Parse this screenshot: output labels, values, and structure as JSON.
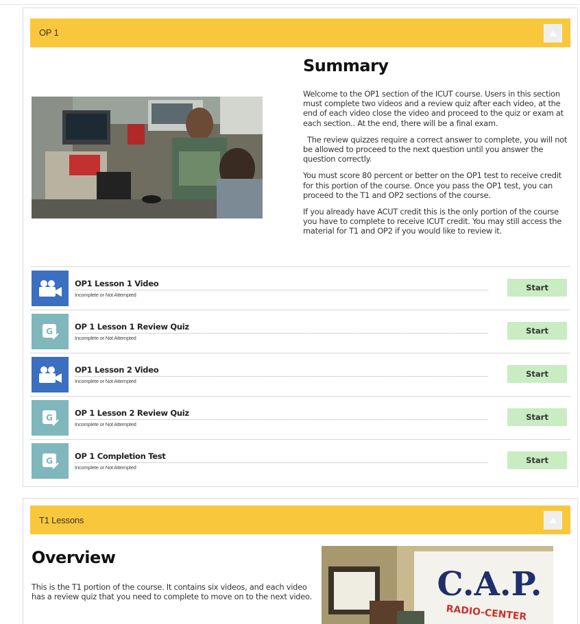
{
  "sections": [
    {
      "title": "OP 1",
      "summary": {
        "heading": "Summary",
        "paragraphs": [
          "Welcome to the OP1 section of the ICUT course. Users in this section must complete two videos and a review quiz after each video, at the end of each video close the video and proceed to the quiz or exam at each section.. At the end, there will be a final exam.",
          "The review quizzes require a correct answer to complete, you will not be allowed to proceed to the next question until you answer the question correctly.",
          "You must score 80 percent or better on the OP1 test to receive credit for this portion of the course. Once you pass the OP1 test, you can proceed to the T1 and OP2 sections of the course.",
          "If you already have ACUT credit this is the only portion of the course you have to complete to receive ICUT credit. You may still access the material for T1 and OP2 if you would like to review it."
        ]
      },
      "lessons": [
        {
          "title": "OP1 Lesson 1 Video",
          "status": "Incomplete or Not Attempted",
          "type_icon": "video-camera-icon",
          "action": "Start"
        },
        {
          "title": "OP 1 Lesson 1 Review Quiz",
          "status": "Incomplete or Not Attempted",
          "type_icon": "quiz-icon",
          "action": "Start"
        },
        {
          "title": "OP1 Lesson 2 Video",
          "status": "Incomplete or Not Attempted",
          "type_icon": "video-camera-icon",
          "action": "Start"
        },
        {
          "title": "OP 1 Lesson 2 Review Quiz",
          "status": "Incomplete or Not Attempted",
          "type_icon": "quiz-icon",
          "action": "Start"
        },
        {
          "title": "OP 1 Completion Test",
          "status": "Incomplete or Not Attempted",
          "type_icon": "quiz-icon",
          "action": "Start"
        }
      ]
    },
    {
      "title": "T1 Lessons",
      "overview": {
        "heading": "Overview",
        "paragraphs": [
          "This is the T1 portion of the course. It contains six videos, and each video has a review quiz that you need to complete to move on to the next video."
        ]
      },
      "photo_sign_text": "C.A.P.",
      "photo_sign_subtext": "RADIO-CENTER"
    }
  ],
  "colors": {
    "header_bg": "#f9c73b",
    "video_icon_bg": "#3b6fbf",
    "quiz_icon_bg": "#7fb7bd",
    "start_button_bg": "#c9ecc3",
    "sign_red": "#c8322f",
    "sign_blue": "#1e2f6b"
  }
}
